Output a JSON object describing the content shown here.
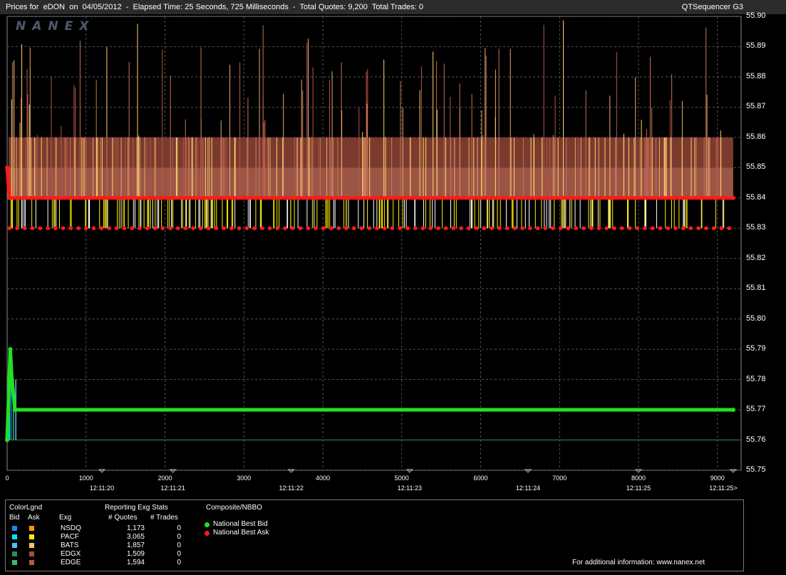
{
  "header": {
    "title": "Prices for  eDON  on  04/05/2012  -  Elapsed Time: 25 Seconds, 725 Milliseconds  -  Total Quotes: 9,200  Total Trades: 0",
    "product": "QTSequencer G3"
  },
  "logo": "NANEX",
  "chart_data": {
    "type": "line",
    "title": "Prices for  eDON  on  04/05/2012",
    "y_ticks": [
      "55.90",
      "55.89",
      "55.88",
      "55.87",
      "55.86",
      "55.85",
      "55.84",
      "55.83",
      "55.82",
      "55.81",
      "55.80",
      "55.79",
      "55.78",
      "55.77",
      "55.76",
      "55.75"
    ],
    "ylim": [
      55.75,
      55.9
    ],
    "x_ticks": [
      "0",
      "1000",
      "2000",
      "3000",
      "4000",
      "5000",
      "6000",
      "7000",
      "8000",
      "9000"
    ],
    "xlim": [
      0,
      9300
    ],
    "time_labels": [
      {
        "x": 1200,
        "label": "12:11:20"
      },
      {
        "x": 2100,
        "label": "12:11:21"
      },
      {
        "x": 3600,
        "label": "12:11:22"
      },
      {
        "x": 5100,
        "label": "12:11:23"
      },
      {
        "x": 6600,
        "label": "12:11:24"
      },
      {
        "x": 8000,
        "label": "12:11:25"
      },
      {
        "x": 9200,
        "label": "12:11:25>"
      }
    ],
    "grid": true,
    "series": [
      {
        "name": "National Best Bid",
        "color": "#22e022",
        "values": [
          [
            0,
            55.76
          ],
          [
            40,
            55.79
          ],
          [
            60,
            55.78
          ],
          [
            100,
            55.77
          ],
          [
            9200,
            55.77
          ]
        ]
      },
      {
        "name": "National Best Ask",
        "color": "#ff1a1a",
        "values": [
          [
            0,
            55.85
          ],
          [
            30,
            55.84
          ],
          [
            9200,
            55.84
          ]
        ]
      }
    ],
    "ask_levels": [
      55.83,
      55.84,
      55.85,
      55.86
    ]
  },
  "legend": {
    "title": "ColorLgnd",
    "bid_header": "Bid",
    "ask_header": "Ask",
    "exg_header": "Exg",
    "stats_title": "Reporting Exg Stats",
    "quotes_header": "# Quotes",
    "trades_header": "# Trades",
    "exchanges": [
      {
        "name": "NSDQ",
        "quotes": "1,173",
        "trades": "0",
        "bid_color": "#1e88e5",
        "ask_color": "#ff9800"
      },
      {
        "name": "PACF",
        "quotes": "3,065",
        "trades": "0",
        "bid_color": "#00e5ff",
        "ask_color": "#ffee00"
      },
      {
        "name": "BATS",
        "quotes": "1,857",
        "trades": "0",
        "bid_color": "#4fc3f7",
        "ask_color": "#ffc266"
      },
      {
        "name": "EDGX",
        "quotes": "1,509",
        "trades": "0",
        "bid_color": "#2e8b57",
        "ask_color": "#a0522d"
      },
      {
        "name": "EDGE",
        "quotes": "1,594",
        "trades": "0",
        "bid_color": "#3cb371",
        "ask_color": "#b5584a"
      }
    ],
    "composite_title": "Composite/NBBO",
    "nbb_label": "National Best Bid",
    "nbo_label": "National Best Ask",
    "nbb_color": "#22e022",
    "nbo_color": "#ff1a1a",
    "footer": "For additional information: www.nanex.net"
  }
}
